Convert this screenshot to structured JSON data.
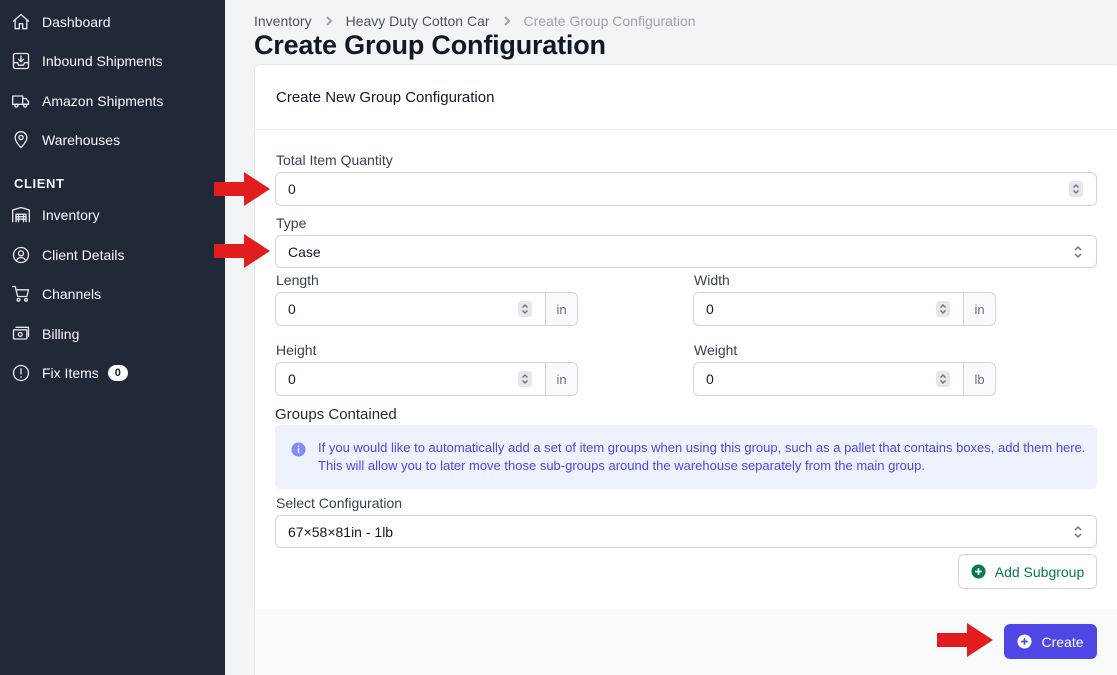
{
  "sidebar": {
    "items": [
      {
        "label": "Dashboard",
        "icon": "home-icon"
      },
      {
        "label": "Inbound Shipments",
        "icon": "inbox-download-icon"
      },
      {
        "label": "Amazon Shipments",
        "icon": "truck-icon"
      },
      {
        "label": "Warehouses",
        "icon": "map-pin-icon"
      }
    ],
    "section_label": "CLIENT",
    "client_items": [
      {
        "label": "Inventory",
        "icon": "warehouse-shelves-icon"
      },
      {
        "label": "Client Details",
        "icon": "user-circle-icon"
      },
      {
        "label": "Channels",
        "icon": "shopping-cart-icon"
      },
      {
        "label": "Billing",
        "icon": "cash-icon"
      },
      {
        "label": "Fix Items",
        "icon": "exclamation-circle-icon",
        "badge": "0"
      }
    ]
  },
  "breadcrumb": [
    "Inventory",
    "Heavy Duty Cotton Car",
    "Create Group Configuration"
  ],
  "page_title": "Create Group Configuration",
  "form": {
    "header": "Create New Group Configuration",
    "total_qty": {
      "label": "Total Item Quantity",
      "value": "0"
    },
    "type": {
      "label": "Type",
      "value": "Case"
    },
    "length": {
      "label": "Length",
      "value": "0",
      "unit": "in"
    },
    "width": {
      "label": "Width",
      "value": "0",
      "unit": "in"
    },
    "height": {
      "label": "Height",
      "value": "0",
      "unit": "in"
    },
    "weight": {
      "label": "Weight",
      "value": "0",
      "unit": "lb"
    },
    "groups_title": "Groups Contained",
    "info_text": "If you would like to automatically add a set of item groups when using this group, such as a pallet that contains boxes, add them here. This will allow you to later move those sub-groups around the warehouse separately from the main group.",
    "select_config": {
      "label": "Select Configuration",
      "value": "67×58×81in - 1lb"
    },
    "add_subgroup_label": "Add Subgroup",
    "create_label": "Create"
  },
  "colors": {
    "sidebar_bg": "#1f2937",
    "primary": "#4f46e5",
    "success": "#047857",
    "annotation_arrow": "#e11d1d"
  }
}
